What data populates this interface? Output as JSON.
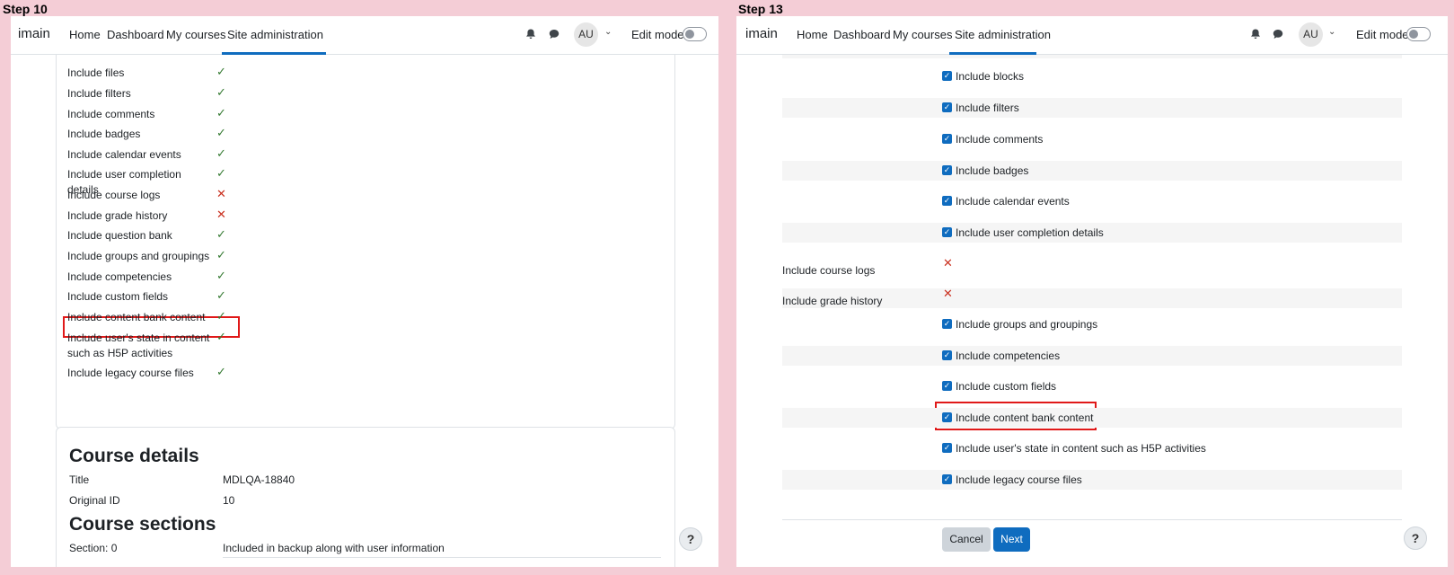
{
  "steps": {
    "left": "Step 10",
    "right": "Step 13"
  },
  "navbar": {
    "brand": "imain",
    "links": [
      "Home",
      "Dashboard",
      "My courses",
      "Site administration"
    ],
    "avatar": "AU",
    "edit_mode": "Edit mode"
  },
  "left": {
    "settings": [
      {
        "label": "Include files",
        "value": "yes"
      },
      {
        "label": "Include filters",
        "value": "yes"
      },
      {
        "label": "Include comments",
        "value": "yes"
      },
      {
        "label": "Include badges",
        "value": "yes"
      },
      {
        "label": "Include calendar events",
        "value": "yes"
      },
      {
        "label": "Include user completion details",
        "value": "yes"
      },
      {
        "label": "Include course logs",
        "value": "no"
      },
      {
        "label": "Include grade history",
        "value": "no"
      },
      {
        "label": "Include question bank",
        "value": "yes"
      },
      {
        "label": "Include groups and groupings",
        "value": "yes"
      },
      {
        "label": "Include competencies",
        "value": "yes"
      },
      {
        "label": "Include custom fields",
        "value": "yes"
      },
      {
        "label": "Include content bank content",
        "value": "yes"
      },
      {
        "label": "Include user's state in content such as H5P activities",
        "value": "yes"
      },
      {
        "label": "Include legacy course files",
        "value": "yes"
      }
    ],
    "course_details": {
      "heading": "Course details",
      "title_label": "Title",
      "title_value": "MDLQA-18840",
      "origid_label": "Original ID",
      "origid_value": "10"
    },
    "course_sections": {
      "heading": "Course sections",
      "section_label": "Section: 0",
      "section_value": "Included in backup along with user information"
    }
  },
  "right": {
    "items": [
      {
        "label": "Include blocks",
        "kind": "checkbox"
      },
      {
        "label": "Include filters",
        "kind": "checkbox"
      },
      {
        "label": "Include comments",
        "kind": "checkbox"
      },
      {
        "label": "Include badges",
        "kind": "checkbox"
      },
      {
        "label": "Include calendar events",
        "kind": "checkbox"
      },
      {
        "label": "Include user completion details",
        "kind": "checkbox"
      },
      {
        "label": "Include course logs",
        "kind": "locked"
      },
      {
        "label": "Include grade history",
        "kind": "locked"
      },
      {
        "label": "Include groups and groupings",
        "kind": "checkbox"
      },
      {
        "label": "Include competencies",
        "kind": "checkbox"
      },
      {
        "label": "Include custom fields",
        "kind": "checkbox"
      },
      {
        "label": "Include content bank content",
        "kind": "checkbox"
      },
      {
        "label": "Include user's state in content such as H5P activities",
        "kind": "checkbox"
      },
      {
        "label": "Include legacy course files",
        "kind": "checkbox"
      }
    ],
    "cancel": "Cancel",
    "next": "Next"
  },
  "help": "?",
  "icons": {
    "check": "check-icon",
    "cross": "cross-icon",
    "bell": "bell-icon",
    "chat": "chat-icon"
  },
  "colors": {
    "accent": "#0f6cbf",
    "success": "#357a32",
    "danger": "#ca3120",
    "highlight": "#e01919"
  }
}
